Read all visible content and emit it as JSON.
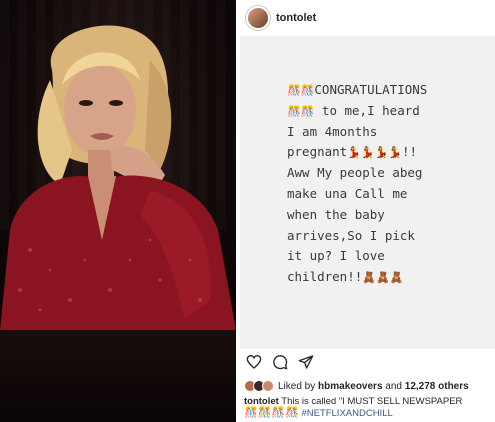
{
  "photo": {
    "description_icon": "woman-portrait-photo"
  },
  "profile": {
    "username": "tontolet",
    "avatar_icon": "profile-avatar-icon"
  },
  "post": {
    "line1_emoji": "🎊🎊",
    "line1_text": "CONGRATULATIONS",
    "line2_emoji": "🎊🎊",
    "line2_text": " to me,I heard",
    "line3": "I am 4months",
    "line4_text": "pregnant",
    "line4_emoji": "💃💃💃💃",
    "line4_tail": "!!",
    "line5": "Aww My people abeg",
    "line6": "make una Call me",
    "line7": "when the baby",
    "line8": "arrives,So I pick",
    "line9": "it up? I love",
    "line10_text": "children!!",
    "line10_emoji": "🧸🧸🧸"
  },
  "actions": {
    "like_icon": "heart-icon",
    "comment_icon": "comment-icon",
    "share_icon": "send-icon"
  },
  "likes": {
    "prefix": "Liked by",
    "user": "hbmakeovers",
    "middle": "and",
    "count": "12,278 others"
  },
  "caption": {
    "username": "tontolet",
    "text": "This is called \"I MUST SELL NEWSPAPER",
    "emoji_line": "🎊🎊🎊🎊",
    "hashtag": "#NETFLIXANDCHILL"
  },
  "colors": {
    "dress": "#8a1420",
    "hair": "#e8c68a",
    "background": "#0d0707",
    "post_bg": "#f1f1f1",
    "text": "#262626",
    "hashtag": "#3b5a86"
  }
}
